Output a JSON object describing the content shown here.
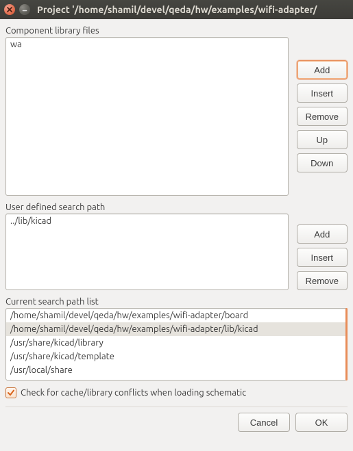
{
  "window": {
    "title": "Project '/home/shamil/devel/qeda/hw/examples/wifi-adapter/"
  },
  "library": {
    "label": "Component library files",
    "items": [
      "wa"
    ],
    "buttons": {
      "add": "Add",
      "insert": "Insert",
      "remove": "Remove",
      "up": "Up",
      "down": "Down"
    }
  },
  "userpath": {
    "label": "User defined search path",
    "value": "../lib/kicad",
    "buttons": {
      "add": "Add",
      "insert": "Insert",
      "remove": "Remove"
    }
  },
  "searchpaths": {
    "label": "Current search path list",
    "items": [
      "/home/shamil/devel/qeda/hw/examples/wifi-adapter/board",
      "/home/shamil/devel/qeda/hw/examples/wifi-adapter/lib/kicad",
      "/usr/share/kicad/library",
      "/usr/share/kicad/template",
      "/usr/local/share"
    ],
    "selected_index": 1
  },
  "checkbox": {
    "label": "Check for cache/library conflicts when loading schematic",
    "checked": true
  },
  "footer": {
    "cancel": "Cancel",
    "ok": "OK"
  }
}
